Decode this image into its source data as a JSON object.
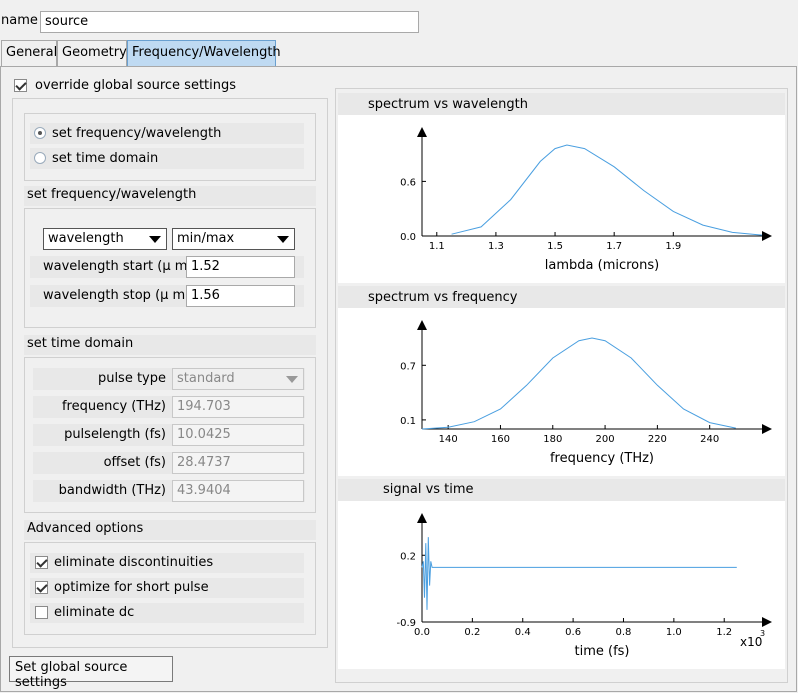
{
  "name_field": {
    "label": "name",
    "value": "source"
  },
  "tabs": [
    {
      "label": "General"
    },
    {
      "label": "Geometry"
    },
    {
      "label": "Frequency/Wavelength"
    }
  ],
  "override": {
    "label": "override global source settings",
    "checked": true
  },
  "mode": {
    "options": [
      {
        "label": "set frequency/wavelength",
        "selected": true
      },
      {
        "label": "set time domain",
        "selected": false
      }
    ]
  },
  "freq_wl": {
    "title": "set frequency/wavelength",
    "type_select": "wavelength",
    "range_select": "min/max",
    "start_label": "wavelength start (μ m)",
    "start_value": "1.52",
    "stop_label": "wavelength stop (μ m)",
    "stop_value": "1.56"
  },
  "time_domain": {
    "title": "set time domain",
    "fields": [
      {
        "label": "pulse type",
        "value": "standard",
        "type": "select"
      },
      {
        "label": "frequency (THz)",
        "value": "194.703"
      },
      {
        "label": "pulselength (fs)",
        "value": "10.0425"
      },
      {
        "label": "offset (fs)",
        "value": "28.4737"
      },
      {
        "label": "bandwidth (THz)",
        "value": "43.9404"
      }
    ]
  },
  "advanced": {
    "title": "Advanced options",
    "options": [
      {
        "label": "eliminate discontinuities",
        "checked": true
      },
      {
        "label": "optimize for short pulse",
        "checked": true
      },
      {
        "label": "eliminate dc",
        "checked": false
      }
    ]
  },
  "global_button": "Set global source settings",
  "accent_color": "#4a9fe0",
  "chart_data": [
    {
      "type": "line",
      "title": "spectrum vs wavelength",
      "xlabel": "lambda (microns)",
      "ylabel": "",
      "xlim": [
        1.05,
        2.2
      ],
      "ylim": [
        0,
        1.0
      ],
      "xticks": [
        "1.1",
        "1.3",
        "1.5",
        "1.7",
        "1.9"
      ],
      "yticks": [
        "0.0",
        "0.6"
      ],
      "series": [
        {
          "x": [
            1.15,
            1.25,
            1.35,
            1.45,
            1.5,
            1.54,
            1.6,
            1.7,
            1.8,
            1.9,
            2.0,
            2.1,
            2.2
          ],
          "y": [
            0.02,
            0.1,
            0.4,
            0.82,
            0.96,
            1.0,
            0.96,
            0.76,
            0.5,
            0.27,
            0.12,
            0.04,
            0.01
          ]
        }
      ]
    },
    {
      "type": "line",
      "title": "spectrum vs frequency",
      "xlabel": "frequency (THz)",
      "ylabel": "",
      "xlim": [
        130,
        260
      ],
      "ylim": [
        0,
        1.0
      ],
      "xticks": [
        "140",
        "160",
        "180",
        "200",
        "220",
        "240"
      ],
      "yticks": [
        "0.1",
        "0.7"
      ],
      "series": [
        {
          "x": [
            130,
            140,
            150,
            160,
            170,
            180,
            190,
            195,
            200,
            210,
            220,
            230,
            240,
            250
          ],
          "y": [
            0.0,
            0.02,
            0.08,
            0.22,
            0.48,
            0.78,
            0.97,
            1.0,
            0.97,
            0.78,
            0.48,
            0.22,
            0.07,
            0.01
          ]
        }
      ]
    },
    {
      "type": "line",
      "title": "signal vs time",
      "xlabel": "time (fs)",
      "ylabel": "",
      "xlim": [
        0,
        1.35
      ],
      "ylim": [
        -0.9,
        0.6
      ],
      "xticks": [
        "0.0",
        "0.2",
        "0.4",
        "0.6",
        "0.8",
        "1.0",
        "1.2"
      ],
      "yticks": [
        "0.2",
        "-0.9"
      ],
      "x_multiplier": "x10",
      "x_exponent": "3",
      "series": [
        {
          "x": [
            0,
            0.005,
            0.01,
            0.015,
            0.02,
            0.025,
            0.03,
            0.035,
            0.04,
            0.05,
            1.25
          ],
          "y": [
            0,
            0.1,
            -0.5,
            0.4,
            -0.7,
            0.5,
            -0.3,
            0.1,
            0,
            0,
            0
          ]
        }
      ]
    }
  ]
}
